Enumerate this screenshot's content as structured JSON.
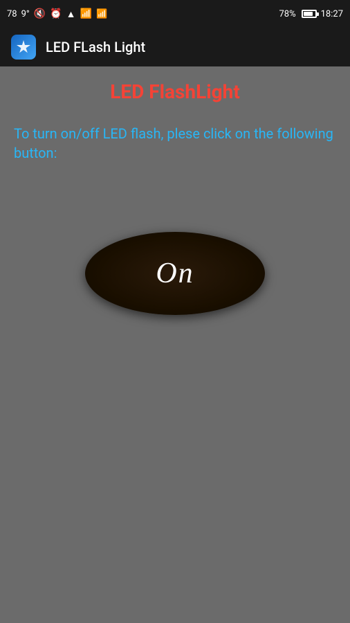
{
  "statusBar": {
    "leftNumber": "78",
    "temperature": "9°",
    "batteryPercent": "78%",
    "time": "18:27"
  },
  "appBar": {
    "title": "LED FLash Light"
  },
  "main": {
    "pageTitle": "LED FlashLight",
    "instructionText": "To turn on/off LED flash, plese click on the following button:",
    "toggleButton": {
      "label": "On"
    }
  }
}
